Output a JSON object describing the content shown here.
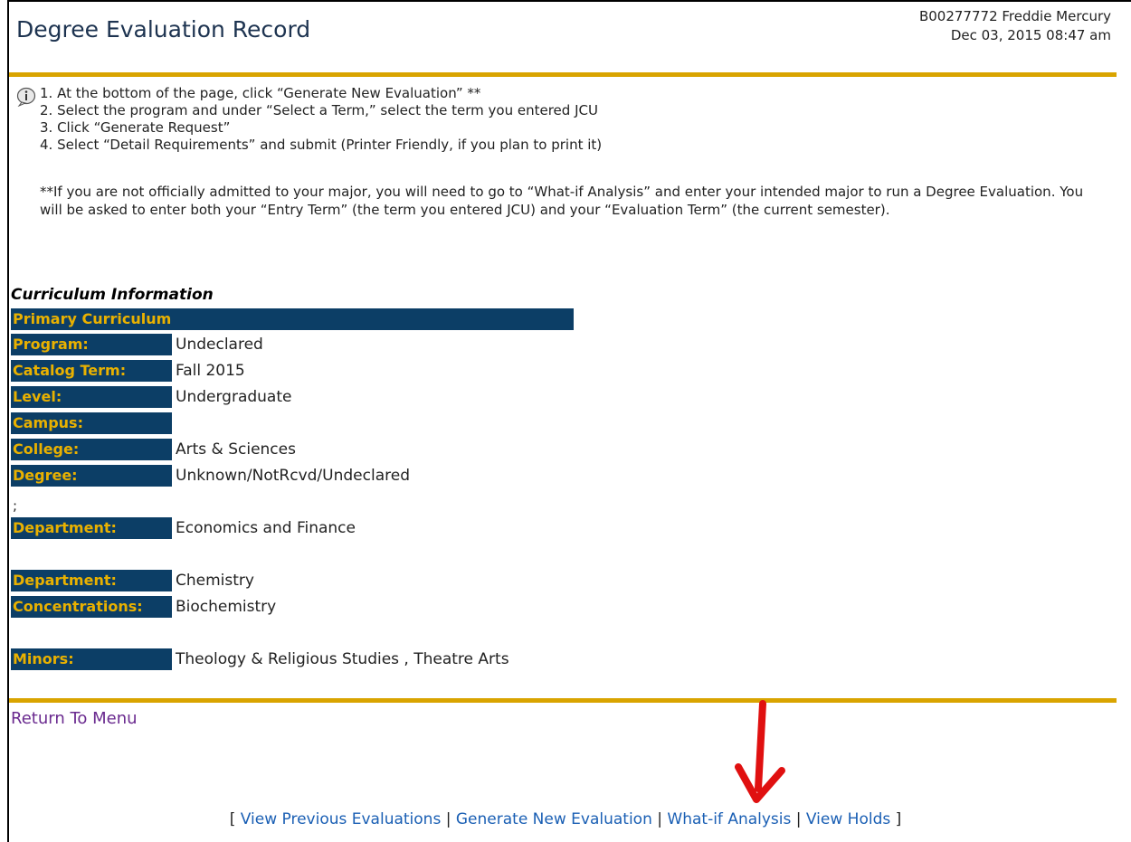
{
  "header": {
    "title": "Degree Evaluation Record",
    "user": "B00277772 Freddie Mercury",
    "datetime": "Dec 03, 2015 08:47 am"
  },
  "instructions": {
    "steps": [
      "1. At the bottom of the page, click “Generate New Evaluation” **",
      "2. Select the program and under “Select a Term,” select the term you entered JCU",
      "3. Click “Generate Request”",
      "4. Select “Detail Requirements” and submit (Printer Friendly, if you plan to print it)"
    ],
    "note": "**If you are not officially admitted to your major, you will need to go to “What-if Analysis” and enter your intended major to run a Degree Evaluation. You will be asked to enter both your “Entry Term” (the term you entered JCU) and your “Evaluation Term” (the current semester)."
  },
  "curriculum": {
    "section_title": "Curriculum Information",
    "primary_header": "Primary Curriculum",
    "rows": [
      {
        "label": "Program:",
        "value": "Undeclared"
      },
      {
        "label": "Catalog Term:",
        "value": "Fall 2015"
      },
      {
        "label": "Level:",
        "value": "Undergraduate"
      },
      {
        "label": "Campus:",
        "value": ""
      },
      {
        "label": "College:",
        "value": "Arts & Sciences"
      },
      {
        "label": "Degree:",
        "value": "Unknown/NotRcvd/Undeclared"
      }
    ],
    "separator": ";",
    "department1": {
      "label": "Department:",
      "value": "Economics and Finance"
    },
    "department2": {
      "label": "Department:",
      "value": "Chemistry"
    },
    "concentrations": {
      "label": "Concentrations:",
      "value": "Biochemistry"
    },
    "minors": {
      "label": "Minors:",
      "value": "Theology & Religious Studies , Theatre Arts"
    }
  },
  "footer": {
    "return_link": "Return To Menu",
    "open_bracket": "[",
    "close_bracket": "]",
    "separator": "|",
    "links": [
      "View Previous Evaluations",
      "Generate New Evaluation",
      "What-if Analysis",
      "View Holds"
    ]
  },
  "colors": {
    "accent_gold": "#d9a400",
    "label_bg": "#0c3e66",
    "label_text": "#e9b100",
    "arrow": "#e01010"
  }
}
